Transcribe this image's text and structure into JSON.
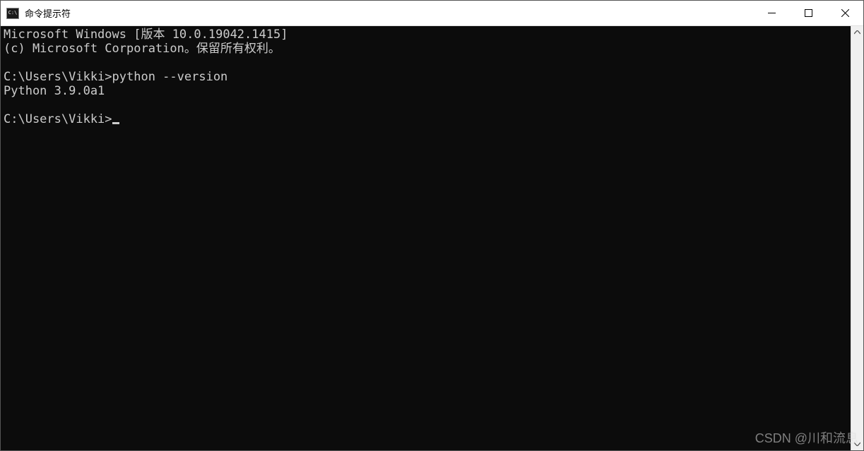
{
  "window": {
    "title": "命令提示符",
    "icon_label": "C:\\"
  },
  "terminal": {
    "lines": {
      "l1": "Microsoft Windows [版本 10.0.19042.1415]",
      "l2": "(c) Microsoft Corporation。保留所有权利。",
      "l3": "",
      "l4_prompt": "C:\\Users\\Vikki>",
      "l4_cmd": "python --version",
      "l5": "Python 3.9.0a1",
      "l6": "",
      "l7_prompt": "C:\\Users\\Vikki>"
    }
  },
  "watermark": "CSDN @川和流息"
}
